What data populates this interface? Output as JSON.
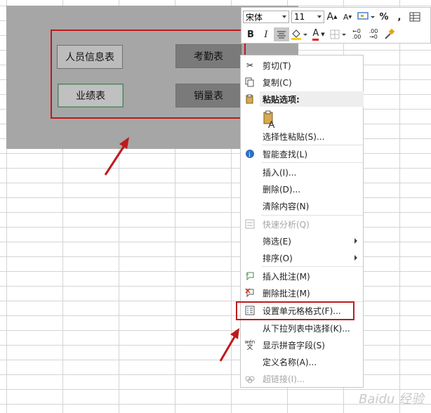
{
  "sheet_buttons": [
    {
      "label": "人员信息表"
    },
    {
      "label": "考勤表"
    },
    {
      "label": "业绩表"
    },
    {
      "label": "销量表"
    }
  ],
  "mini_toolbar": {
    "font_name": "宋体",
    "font_size": "11",
    "grow_font": "A",
    "shrink_font": "A",
    "percent": "%",
    "comma": ",",
    "bold": "B",
    "italic": "I",
    "font_color_letter": "A",
    "increase_decimal": ".00",
    "decrease_decimal": ".00"
  },
  "context_menu": {
    "cut": "剪切(T)",
    "copy": "复制(C)",
    "paste_options_header": "粘贴选项:",
    "paste_special": "选择性粘贴(S)...",
    "smart_lookup": "智能查找(L)",
    "insert": "插入(I)...",
    "delete": "删除(D)...",
    "clear_contents": "清除内容(N)",
    "quick_analysis": "快速分析(Q)",
    "filter": "筛选(E)",
    "sort": "排序(O)",
    "insert_comment": "插入批注(M)",
    "delete_comment": "删除批注(M)",
    "format_cells": "设置单元格格式(F)...",
    "pick_from_list": "从下拉列表中选择(K)...",
    "show_phonetic": "显示拼音字段(S)",
    "define_name": "定义名称(A)...",
    "hyperlink": "超链接(I)..."
  },
  "phonetic_icon_text": {
    "top": "wén",
    "bottom": "文"
  },
  "watermark": "Baidu 经验",
  "colors": {
    "highlight_red": "#c0191c",
    "gray_area": "#a6a6a6"
  }
}
